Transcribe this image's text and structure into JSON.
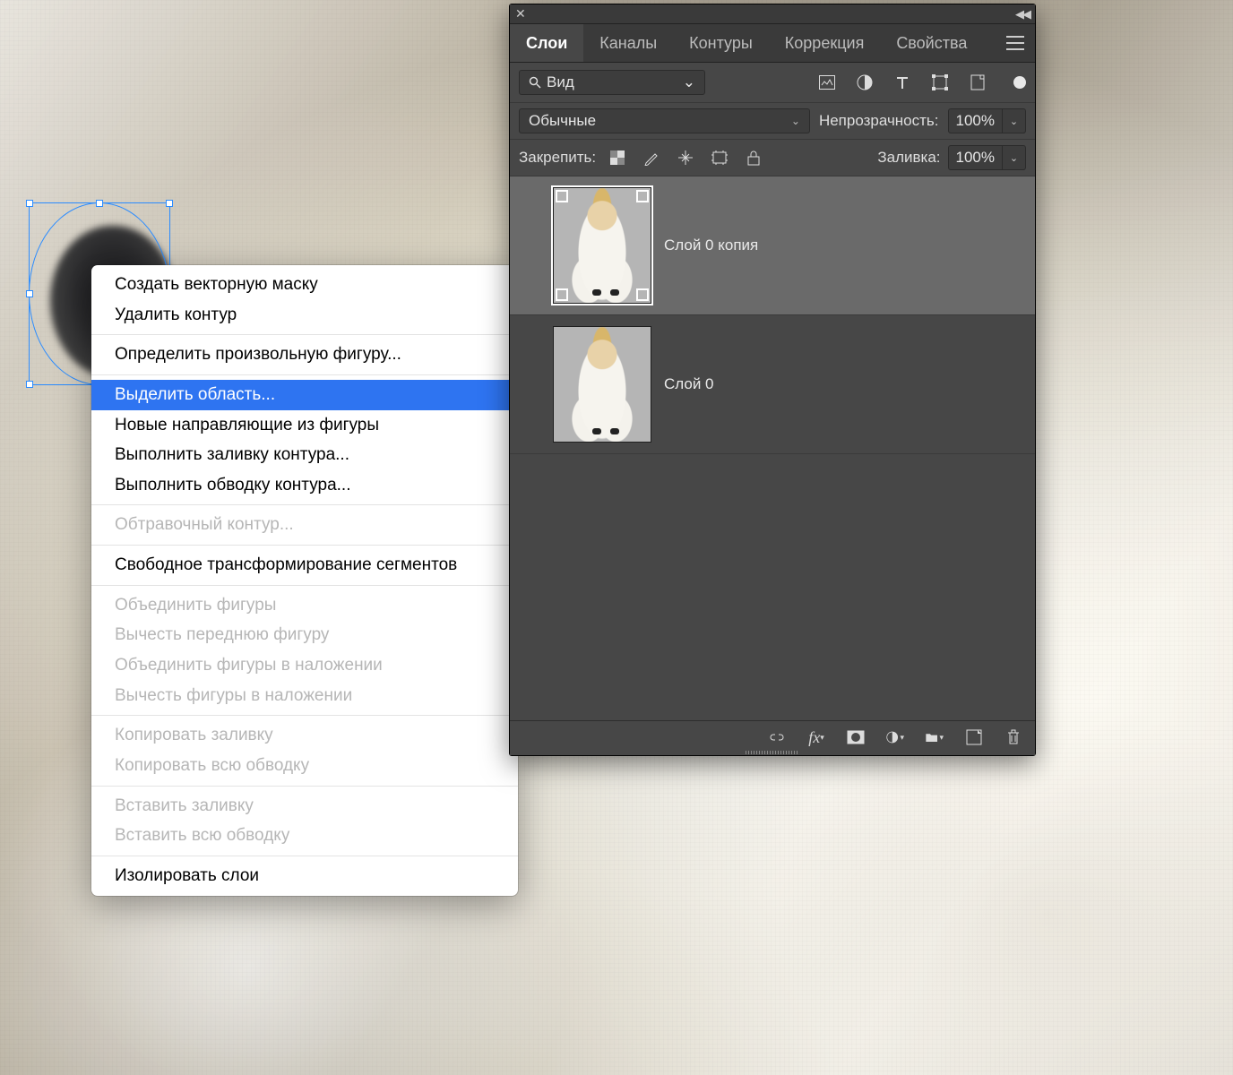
{
  "panel": {
    "tabs": [
      "Слои",
      "Каналы",
      "Контуры",
      "Коррекция",
      "Свойства"
    ],
    "active_tab_index": 0,
    "search_filter_label": "Вид",
    "filter_icons": [
      "image-icon",
      "adjust-icon",
      "type-icon",
      "shape-icon",
      "smart-icon"
    ],
    "blend_mode": "Обычные",
    "opacity_label": "Непрозрачность:",
    "opacity_value": "100%",
    "lock_label": "Закрепить:",
    "fill_label": "Заливка:",
    "fill_value": "100%"
  },
  "layers": [
    {
      "name": "Слой 0 копия",
      "selected": true
    },
    {
      "name": "Слой 0",
      "selected": false
    }
  ],
  "context_menu": {
    "groups": [
      [
        {
          "label": "Создать векторную маску",
          "enabled": true
        },
        {
          "label": "Удалить контур",
          "enabled": true
        }
      ],
      [
        {
          "label": "Определить произвольную фигуру...",
          "enabled": true
        }
      ],
      [
        {
          "label": "Выделить область...",
          "enabled": true,
          "highlighted": true
        },
        {
          "label": "Новые направляющие из фигуры",
          "enabled": true
        },
        {
          "label": "Выполнить заливку контура...",
          "enabled": true
        },
        {
          "label": "Выполнить обводку контура...",
          "enabled": true
        }
      ],
      [
        {
          "label": "Обтравочный контур...",
          "enabled": false
        }
      ],
      [
        {
          "label": "Свободное трансформирование сегментов",
          "enabled": true
        }
      ],
      [
        {
          "label": "Объединить фигуры",
          "enabled": false
        },
        {
          "label": "Вычесть переднюю фигуру",
          "enabled": false
        },
        {
          "label": "Объединить фигуры в наложении",
          "enabled": false
        },
        {
          "label": "Вычесть фигуры в наложении",
          "enabled": false
        }
      ],
      [
        {
          "label": "Копировать заливку",
          "enabled": false
        },
        {
          "label": "Копировать всю обводку",
          "enabled": false
        }
      ],
      [
        {
          "label": "Вставить заливку",
          "enabled": false
        },
        {
          "label": "Вставить всю обводку",
          "enabled": false
        }
      ],
      [
        {
          "label": "Изолировать слои",
          "enabled": true
        }
      ]
    ]
  }
}
